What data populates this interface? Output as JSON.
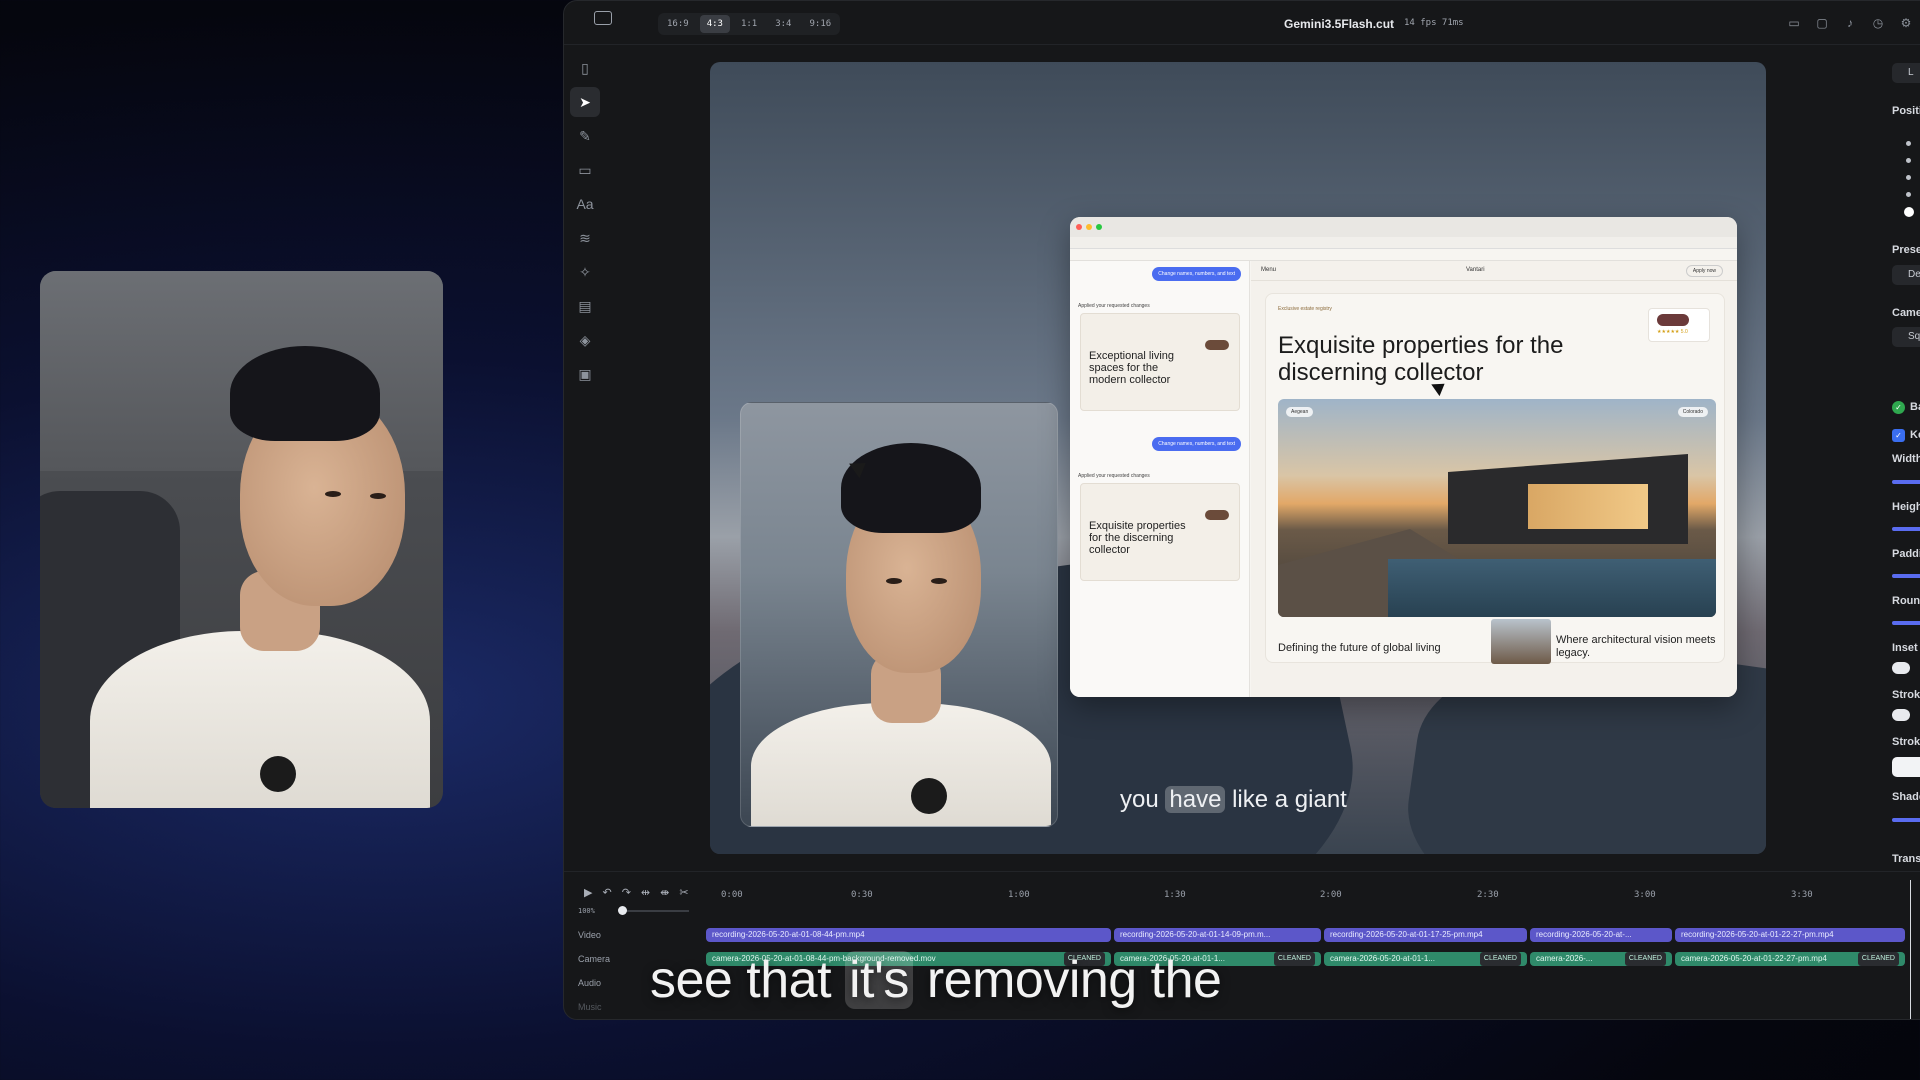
{
  "editor": {
    "aspect_ratios": [
      "16:9",
      "4:3",
      "1:1",
      "3:4",
      "9:16"
    ],
    "active_aspect": "4:3",
    "title": "Gemini3.5Flash.cut",
    "meta": "14 fps 71ms"
  },
  "tools": [
    "sidebar-toggle",
    "select",
    "pen",
    "rectangle",
    "text",
    "audio",
    "magic",
    "notes",
    "layers",
    "media"
  ],
  "tool_text_label": "Aa",
  "browser": {
    "chat_bubble_1": "Change names, numbers, and text",
    "chat_note_1": "Applied your requested changes",
    "card_1_title": "Exceptional living spaces for the modern collector",
    "chat_bubble_2": "Change names, numbers, and text",
    "chat_note_2": "Applied your requested changes",
    "card_2_title": "Exquisite properties for the discerning collector",
    "site_menu": "Menu",
    "site_logo": "Vantari",
    "site_apply": "Apply now",
    "hero_badge": "Exclusive estate registry",
    "hero_title": "Exquisite properties for the discerning collector",
    "rating_stars": "★★★★★ 5.0",
    "chip_left": "Aegean",
    "chip_right": "Colorado",
    "hero_sub": "Defining the future of global living",
    "hero_sub2": "Where architectural vision meets legacy."
  },
  "canvas_caption": {
    "before": "you ",
    "highlight": "have",
    "after": " like a giant"
  },
  "right_panel": {
    "labels": [
      "L",
      "Positio",
      "Preset",
      "Defa",
      "Camer",
      "Squ",
      "Ba",
      "Ke",
      "Width",
      "Height",
      "Paddin",
      "Round",
      "Inset",
      "Stroke",
      "Stroke",
      "Shadow",
      "Transit"
    ]
  },
  "timeline": {
    "zoom": "100%",
    "ruler": [
      "0:00",
      "0:30",
      "1:00",
      "1:30",
      "2:00",
      "2:30",
      "3:00",
      "3:30"
    ],
    "tracks": [
      "Video",
      "Camera",
      "Audio",
      "Music"
    ],
    "video_clips": [
      "recording-2026-05-20-at-01-08-44-pm.mp4",
      "recording-2026-05-20-at-01-14-09-pm.m...",
      "recording-2026-05-20-at-01-17-25-pm.mp4",
      "recording-2026-05-20-at-...",
      "recording-2026-05-20-at-01-22-27-pm.mp4"
    ],
    "camera_clips": [
      "camera-2026-05-20-at-01-08-44-pm-background-removed.mov",
      "camera-2026-05-20-at-01-1...",
      "camera-2026-05-20-at-01-1...",
      "camera-2026-...",
      "camera-2026-05-20-at-01-22-27-pm.mp4"
    ],
    "clip_badge": "CLEANED"
  },
  "bottom_caption": {
    "before": "see that ",
    "highlight": "it's",
    "after": " removing the"
  }
}
